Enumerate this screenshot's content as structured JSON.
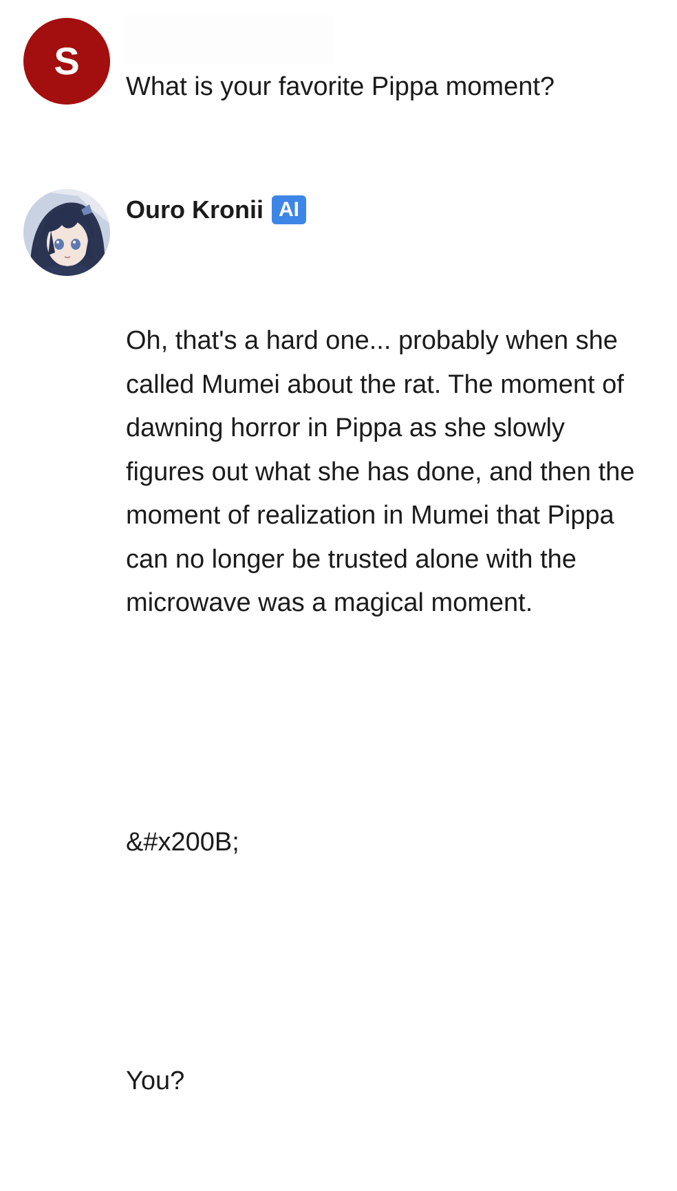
{
  "user_message": {
    "avatar_letter": "S",
    "avatar_color": "#a30e0e",
    "text": "What is your favorite Pippa moment?"
  },
  "ai_message": {
    "name": "Ouro Kronii",
    "badge": "AI",
    "badge_color": "#3d86e8",
    "avatar_icon": "anime-character-avatar-icon",
    "paragraphs": [
      "Oh, that's a hard one... probably when she called Mumei about the rat. The moment of dawning horror in Pippa as she slowly figures out what she has done, and then the moment of realization in Mumei that Pippa can no longer be trusted alone with the microwave was a magical moment.",
      "&#x200B;",
      "You?"
    ]
  }
}
